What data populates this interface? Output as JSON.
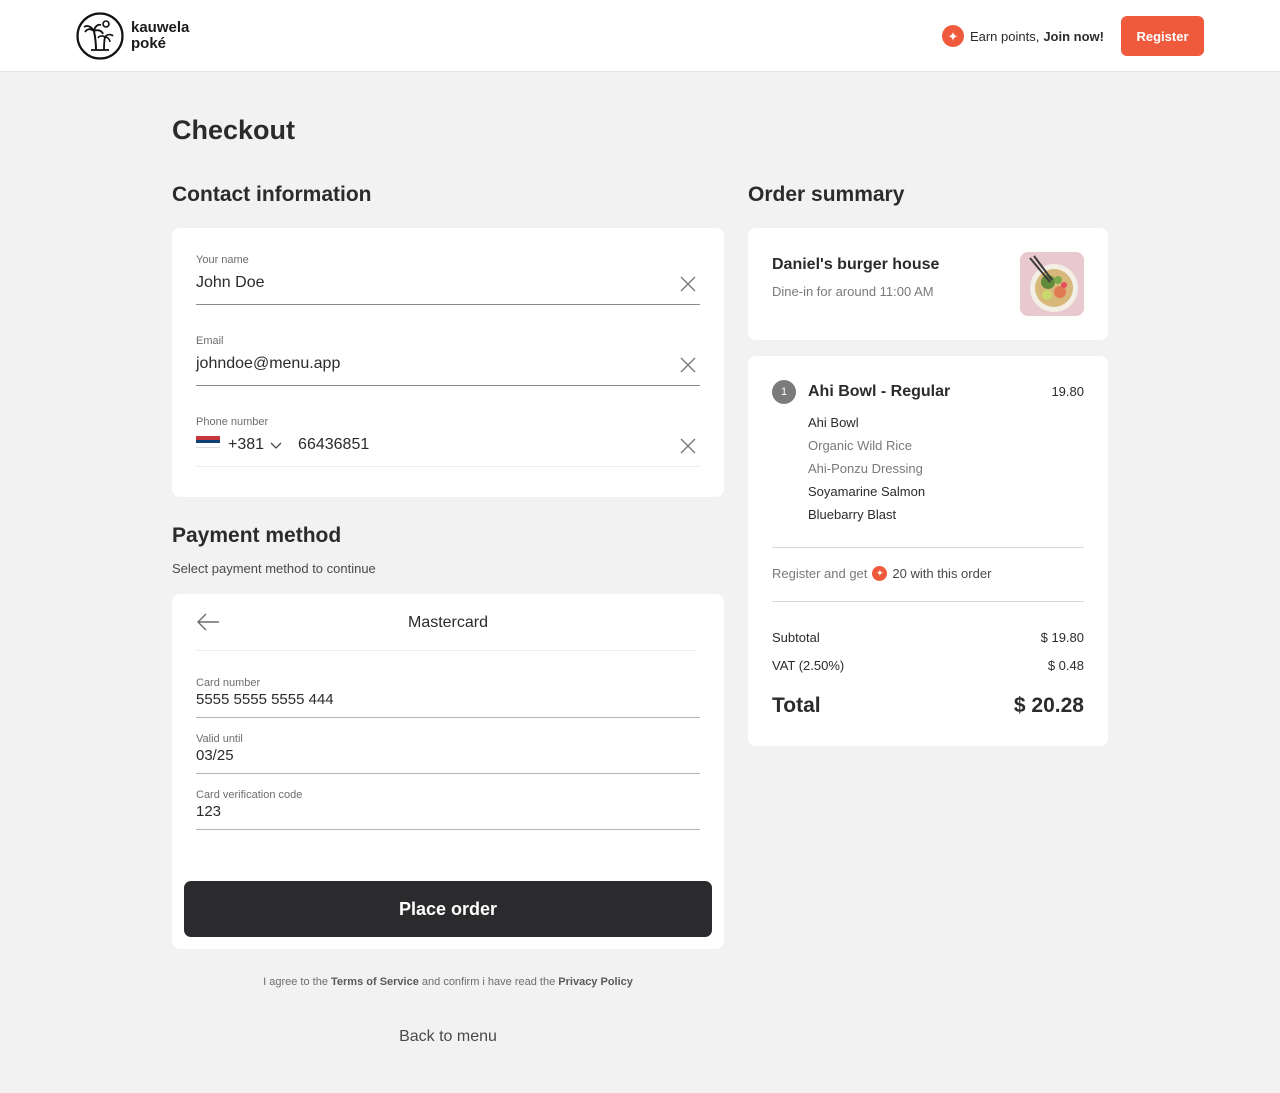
{
  "brand": {
    "name_line1": "kauwela",
    "name_line2": "poké",
    "accent": "#f05a3c"
  },
  "header": {
    "earn_text": "Earn points,",
    "join_text": "Join now!",
    "register_label": "Register",
    "star_icon": "+"
  },
  "page_title": "Checkout",
  "contact": {
    "title": "Contact information",
    "name": {
      "label": "Your name",
      "value": "John Doe"
    },
    "email": {
      "label": "Email",
      "value": "johndoe@menu.app"
    },
    "phone": {
      "label": "Phone number",
      "country_code": "+381",
      "number": "66436851",
      "flag": "serbia-flag"
    }
  },
  "payment": {
    "title": "Payment method",
    "subtitle": "Select payment method to continue",
    "method": "Mastercard",
    "card_number": {
      "label": "Card number",
      "value": "5555 5555 5555 444"
    },
    "valid_until": {
      "label": "Valid until",
      "value": "03/25"
    },
    "cvc": {
      "label": "Card verification code",
      "value": "123"
    },
    "place_order_label": "Place order"
  },
  "agree": {
    "pre": "I agree to the",
    "terms": "Terms of Service",
    "mid": "and confirm i have read the",
    "privacy": "Privacy Policy"
  },
  "back_to_menu": "Back to menu",
  "summary": {
    "title": "Order summary",
    "restaurant": "Daniel's burger house",
    "dine_in": "Dine-in for around 11:00 AM",
    "item": {
      "qty": "1",
      "name": "Ahi Bowl - Regular",
      "price": "19.80",
      "modifiers": [
        {
          "text": "Ahi Bowl",
          "tone": "dark"
        },
        {
          "text": "Organic Wild Rice",
          "tone": "light"
        },
        {
          "text": "Ahi-Ponzu Dressing",
          "tone": "light"
        },
        {
          "text": "Soyamarine Salmon",
          "tone": "dark"
        },
        {
          "text": "Bluebarry Blast",
          "tone": "dark"
        }
      ]
    },
    "register_pre": "Register and get",
    "register_points": "20 with this order",
    "subtotal_label": "Subtotal",
    "subtotal_value": "$ 19.80",
    "vat_label": "VAT (2.50%)",
    "vat_value": "$ 0.48",
    "total_label": "Total",
    "total_value": "$ 20.28"
  }
}
